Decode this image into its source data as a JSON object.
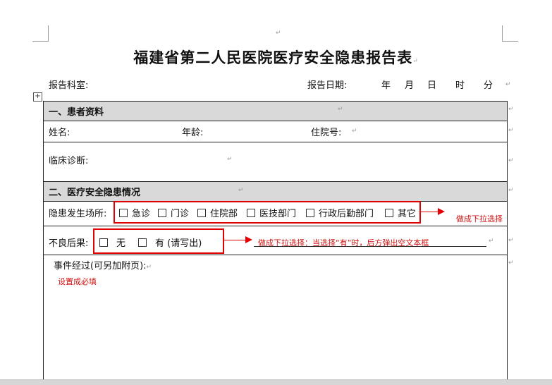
{
  "doc": {
    "title": "福建省第二人民医院医疗安全隐患报告表",
    "report_dept_label": "报告科室:",
    "report_date_label": "报告日期:",
    "date_units": {
      "year": "年",
      "month": "月",
      "day": "日",
      "hour": "时",
      "minute": "分"
    },
    "para_mark": "↵",
    "section1": {
      "heading": "一、患者资料",
      "name_label": "姓名:",
      "age_label": "年龄:",
      "admission_label": "住院号:",
      "diagnosis_label": "临床诊断:"
    },
    "section2": {
      "heading": "二、医疗安全隐患情况",
      "location_label": "隐患发生场所:",
      "location_options": [
        "急诊",
        "门诊",
        "住院部",
        "医技部门",
        "行政后勤部门",
        "其它"
      ],
      "consequence_label": "不良后果:",
      "consequence_options": [
        "无",
        "有 (请写出)"
      ],
      "event_label": "事件经过(可另加附页):"
    }
  },
  "annotations": {
    "location_note": "做成下拉选择",
    "consequence_note": "做成下拉选择：当选择“有”时，后方弹出空文本框",
    "required_note": "设置成必填"
  },
  "colors": {
    "annotation": "#e00000",
    "header_shade": "#d9d9d9"
  }
}
